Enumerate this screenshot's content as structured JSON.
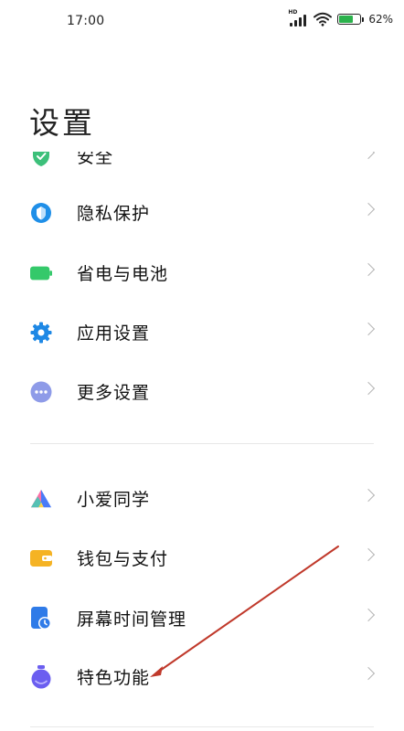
{
  "status_bar": {
    "time": "17:00",
    "signal_tag": "HD",
    "battery_percent": "62%",
    "battery_level": 0.62
  },
  "page": {
    "title": "设置"
  },
  "settings": {
    "items": [
      {
        "label": "安全",
        "icon": "security-shield-icon",
        "color": "#3cc07a"
      },
      {
        "label": "隐私保护",
        "icon": "privacy-icon",
        "color": "#1f8fe8"
      },
      {
        "label": "省电与电池",
        "icon": "battery-icon",
        "color": "#34c96a"
      },
      {
        "label": "应用设置",
        "icon": "gear-icon",
        "color": "#1e88e5"
      },
      {
        "label": "更多设置",
        "icon": "more-dots-icon",
        "color": "#8e9be8"
      }
    ],
    "items2": [
      {
        "label": "小爱同学",
        "icon": "xiaoai-icon",
        "color": "#4a7bf7"
      },
      {
        "label": "钱包与支付",
        "icon": "wallet-icon",
        "color": "#f5b324"
      },
      {
        "label": "屏幕时间管理",
        "icon": "screen-time-icon",
        "color": "#2f7be8"
      },
      {
        "label": "特色功能",
        "icon": "special-features-icon",
        "color": "#6b5ef0"
      }
    ]
  },
  "colors": {
    "annotation_arrow": "#c0392b"
  }
}
